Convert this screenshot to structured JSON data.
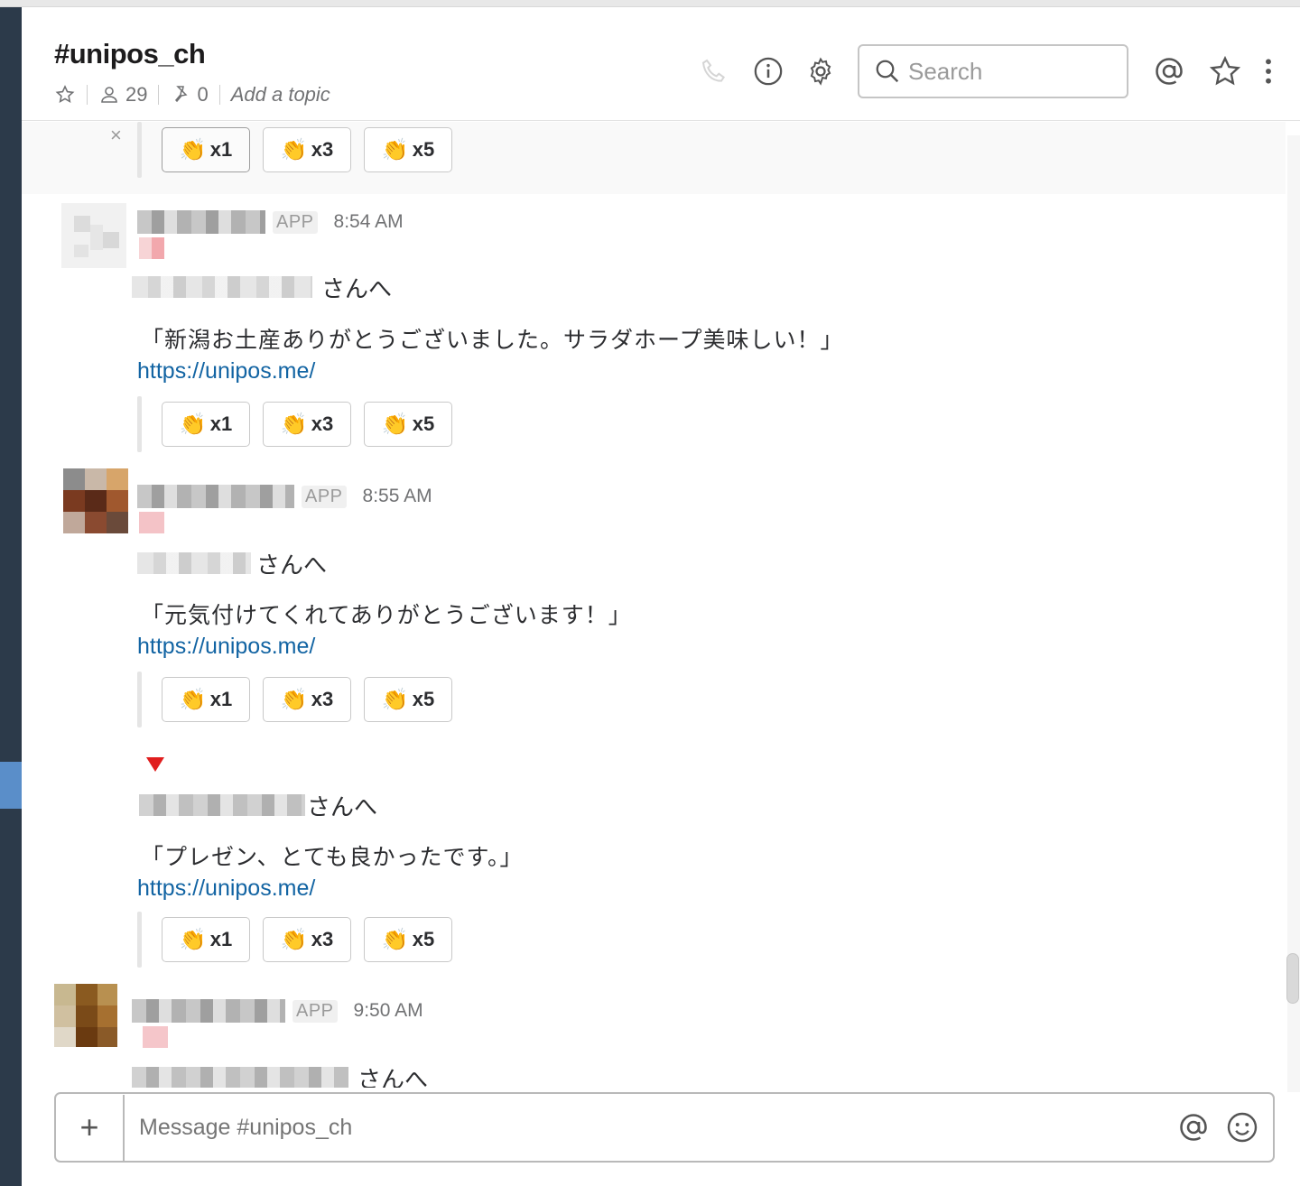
{
  "channel": {
    "name": "#unipos_ch",
    "members": "29",
    "pins": "0",
    "topic": "Add a topic"
  },
  "header": {
    "search_placeholder": "Search"
  },
  "top_buttons": [
    {
      "label": "x1",
      "pressed": true
    },
    {
      "label": "x3"
    },
    {
      "label": "x5"
    }
  ],
  "messages": [
    {
      "app": "APP",
      "time": "8:54 AM",
      "to_suffix": "さんへ",
      "text": "「新潟お土産ありがとうございました。サラダホープ美味しい！」",
      "link": "https://unipos.me/",
      "buttons": [
        "x1",
        "x3",
        "x5"
      ]
    },
    {
      "app": "APP",
      "time": "8:55 AM",
      "to_suffix": "さんへ",
      "text": "「元気付けてくれてありがとうございます！」",
      "link": "https://unipos.me/",
      "buttons": [
        "x1",
        "x3",
        "x5"
      ]
    },
    {
      "to_suffix": "さんへ",
      "text": "「プレゼン、とても良かったです。」",
      "link": "https://unipos.me/",
      "buttons": [
        "x1",
        "x3",
        "x5"
      ]
    },
    {
      "app": "APP",
      "time": "9:50 AM",
      "to_suffix": "さんへ"
    }
  ],
  "composer": {
    "placeholder": "Message #unipos_ch"
  },
  "colors": {
    "sidebar": "#2c3a4a",
    "link": "#1264a3",
    "active_marker": "#5a8ec9"
  },
  "icons": {
    "close": "×",
    "clap": "👏",
    "plus": "+"
  }
}
